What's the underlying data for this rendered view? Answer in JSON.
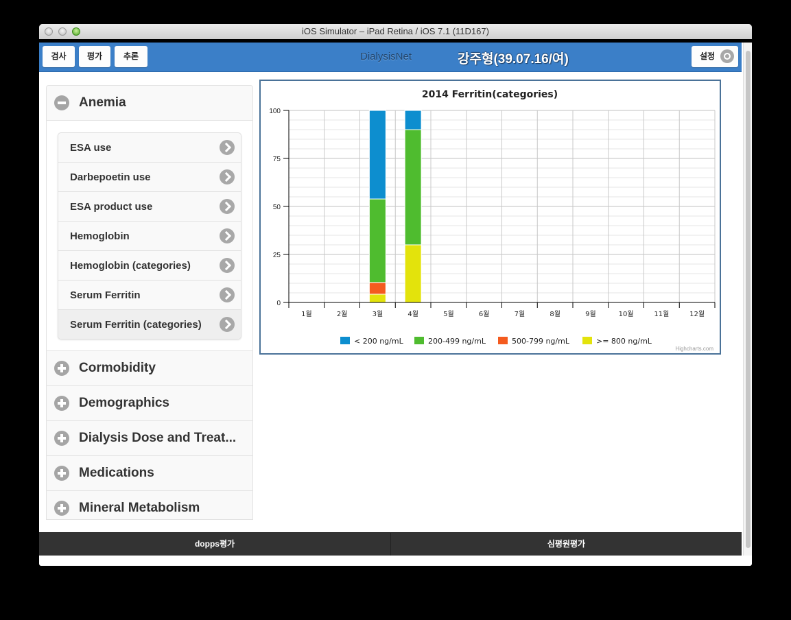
{
  "window": {
    "title": "iOS Simulator – iPad Retina / iOS 7.1 (11D167)"
  },
  "header": {
    "buttons": [
      {
        "label": "검사"
      },
      {
        "label": "평가"
      },
      {
        "label": "추론"
      }
    ],
    "brand": "DialysisNet",
    "patient": "강주형(39.07.16/여)",
    "settings_label": "설정",
    "accent_color": "#3b7fc8"
  },
  "sidebar": {
    "sections": [
      {
        "label": "Anemia",
        "expanded": true,
        "icon": "minus-circle-icon",
        "items": [
          {
            "label": "ESA use"
          },
          {
            "label": "Darbepoetin use"
          },
          {
            "label": "ESA product use"
          },
          {
            "label": "Hemoglobin"
          },
          {
            "label": "Hemoglobin (categories)"
          },
          {
            "label": "Serum Ferritin"
          },
          {
            "label": "Serum Ferritin (categories)",
            "selected": true
          }
        ]
      },
      {
        "label": "Cormobidity",
        "expanded": false,
        "icon": "plus-circle-icon"
      },
      {
        "label": "Demographics",
        "expanded": false,
        "icon": "plus-circle-icon"
      },
      {
        "label": "Dialysis Dose and Treat...",
        "expanded": false,
        "icon": "plus-circle-icon"
      },
      {
        "label": "Medications",
        "expanded": false,
        "icon": "plus-circle-icon"
      },
      {
        "label": "Mineral Metabolism",
        "expanded": false,
        "icon": "plus-circle-icon"
      }
    ]
  },
  "chart_data": {
    "type": "bar",
    "stacked": true,
    "title": "2014 Ferritin(categories)",
    "xlabel": "",
    "ylabel": "",
    "categories": [
      "1월",
      "2월",
      "3월",
      "4월",
      "5월",
      "6월",
      "7월",
      "8월",
      "9월",
      "10월",
      "11월",
      "12월"
    ],
    "ylim": [
      0,
      100
    ],
    "yticks": [
      0,
      25,
      50,
      75,
      100
    ],
    "grid": true,
    "legend_position": "bottom-center",
    "credits": "Highcharts.com",
    "series": [
      {
        "name": "< 200 ng/mL",
        "color": "#0d8ecf",
        "values": [
          0,
          0,
          46.1,
          10,
          0,
          0,
          0,
          0,
          0,
          0,
          0,
          0
        ]
      },
      {
        "name": "200-499 ng/mL",
        "color": "#4fbc2f",
        "values": [
          0,
          0,
          43.5,
          60,
          0,
          0,
          0,
          0,
          0,
          0,
          0,
          0
        ]
      },
      {
        "name": "500-799 ng/mL",
        "color": "#f45b1f",
        "values": [
          0,
          0,
          6.1,
          0,
          0,
          0,
          0,
          0,
          0,
          0,
          0,
          0
        ]
      },
      {
        "name": ">= 800 ng/mL",
        "color": "#e3e30c",
        "values": [
          0,
          0,
          4.3,
          30,
          0,
          0,
          0,
          0,
          0,
          0,
          0,
          0
        ]
      }
    ]
  },
  "footer": {
    "tabs": [
      {
        "label": "dopps평가"
      },
      {
        "label": "심평원평가"
      }
    ]
  }
}
